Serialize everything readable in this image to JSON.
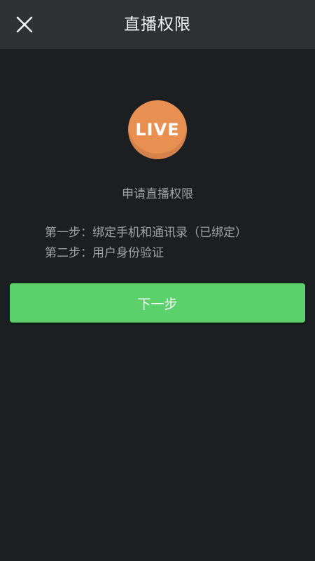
{
  "header": {
    "title": "直播权限",
    "close_icon": "close-icon"
  },
  "logo": {
    "text": "LIVE",
    "color": "#e88f52"
  },
  "main": {
    "apply_title": "申请直播权限",
    "steps": [
      "第一步：绑定手机和通讯录（已绑定）",
      "第二步：用户身份验证"
    ],
    "next_button": "下一步"
  },
  "colors": {
    "background": "#1c1f22",
    "topbar": "#2e3134",
    "accent_green": "#5bd06b"
  }
}
